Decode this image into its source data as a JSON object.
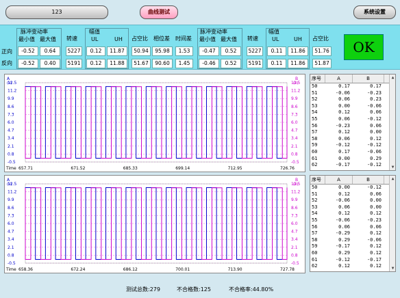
{
  "header": {
    "title_value": "123",
    "curve_button": "曲线测试",
    "settings_button": "系统设置"
  },
  "params": {
    "group1_title": "脉冲变动率",
    "group2_title": "幅值",
    "group3_title": "脉冲变动率",
    "group4_title": "幅值",
    "min_label": "最小值",
    "max_label": "最大值",
    "speed_label": "转速",
    "ul_label": "UL",
    "uh_label": "UH",
    "duty_label": "占空比",
    "phase_label": "相位差",
    "time_label": "时间差",
    "forward_label": "正向",
    "reverse_label": "反向",
    "forward": {
      "min1": "-0.52",
      "max1": "0.64",
      "speed1": "5227",
      "ul1": "0.12",
      "uh1": "11.87",
      "duty1": "50.94",
      "phase": "95.98",
      "time": "1.53",
      "min2": "-0.47",
      "max2": "0.52",
      "speed2": "5227",
      "ul2": "0.11",
      "uh2": "11.86",
      "duty2": "51.76"
    },
    "reverse": {
      "min1": "-0.52",
      "max1": "0.40",
      "speed1": "5191",
      "ul1": "0.12",
      "uh1": "11.88",
      "duty1": "51.67",
      "phase": "90.60",
      "time": "1.45",
      "min2": "-0.46",
      "max2": "0.52",
      "speed2": "5191",
      "ul2": "0.11",
      "uh2": "11.86",
      "duty2": "51.87"
    },
    "ok_text": "OK"
  },
  "chart_data": [
    {
      "type": "line",
      "left_axis_label": "A",
      "left_axis_unit": "(V)",
      "right_axis_label": "B",
      "right_axis_unit": "(V)",
      "y_ticks": [
        "12.5",
        "11.2",
        "9.9",
        "8.6",
        "7.3",
        "6.0",
        "4.7",
        "3.4",
        "2.1",
        "0.8",
        "-0.5"
      ],
      "ylim": [
        -0.5,
        12.5
      ],
      "x_label": "Time",
      "x_ticks": [
        "657.71",
        "671.52",
        "685.33",
        "699.14",
        "712.95",
        "726.76"
      ],
      "series": [
        {
          "name": "A",
          "color": "#0000cc",
          "high": 11.87,
          "low": 0.12
        },
        {
          "name": "B",
          "color": "#cc00cc",
          "high": 11.86,
          "low": 0.11
        }
      ],
      "periods": 13
    },
    {
      "type": "line",
      "left_axis_label": "A",
      "left_axis_unit": "(V)",
      "right_axis_label": "B",
      "right_axis_unit": "(V)",
      "y_ticks": [
        "12.5",
        "11.2",
        "9.9",
        "8.6",
        "7.3",
        "6.0",
        "4.7",
        "3.4",
        "2.1",
        "0.8",
        "-0.5"
      ],
      "ylim": [
        -0.5,
        12.5
      ],
      "x_label": "Time",
      "x_ticks": [
        "658.36",
        "672.24",
        "686.12",
        "700.01",
        "713.90",
        "727.78"
      ],
      "series": [
        {
          "name": "A",
          "color": "#0000cc",
          "high": 11.88,
          "low": 0.12
        },
        {
          "name": "B",
          "color": "#cc00cc",
          "high": 11.86,
          "low": 0.11
        }
      ],
      "periods": 13
    }
  ],
  "table1": {
    "headers": [
      "序号",
      "A",
      "B"
    ],
    "rows": [
      [
        "50",
        "0.17",
        "0.17"
      ],
      [
        "51",
        "-0.06",
        "-0.23"
      ],
      [
        "52",
        "0.06",
        "0.23"
      ],
      [
        "53",
        "0.00",
        "-0.06"
      ],
      [
        "54",
        "0.12",
        "0.06"
      ],
      [
        "55",
        "0.06",
        "-0.12"
      ],
      [
        "56",
        "-0.23",
        "0.06"
      ],
      [
        "57",
        "0.12",
        "0.00"
      ],
      [
        "58",
        "0.06",
        "0.12"
      ],
      [
        "59",
        "-0.12",
        "-0.12"
      ],
      [
        "60",
        "0.17",
        "-0.06"
      ],
      [
        "61",
        "0.00",
        "0.29"
      ],
      [
        "62",
        "-0.17",
        "-0.12"
      ]
    ]
  },
  "table2": {
    "headers": [
      "序号",
      "A",
      "B"
    ],
    "rows": [
      [
        "50",
        "0.00",
        "-0.12"
      ],
      [
        "51",
        "0.12",
        "0.06"
      ],
      [
        "52",
        "-0.06",
        "0.00"
      ],
      [
        "53",
        "0.06",
        "0.00"
      ],
      [
        "54",
        "0.12",
        "0.12"
      ],
      [
        "55",
        "-0.06",
        "-0.23"
      ],
      [
        "56",
        "0.06",
        "0.06"
      ],
      [
        "57",
        "-0.29",
        "0.12"
      ],
      [
        "58",
        "0.29",
        "-0.06"
      ],
      [
        "59",
        "-0.17",
        "0.12"
      ],
      [
        "60",
        "0.29",
        "0.12"
      ],
      [
        "61",
        "-0.12",
        "-0.17"
      ],
      [
        "62",
        "0.12",
        "0.12"
      ]
    ]
  },
  "status": {
    "total_label": "测试总数:279",
    "fail_label": "不合格数:125",
    "rate_label": "不合格率:44.80%"
  }
}
